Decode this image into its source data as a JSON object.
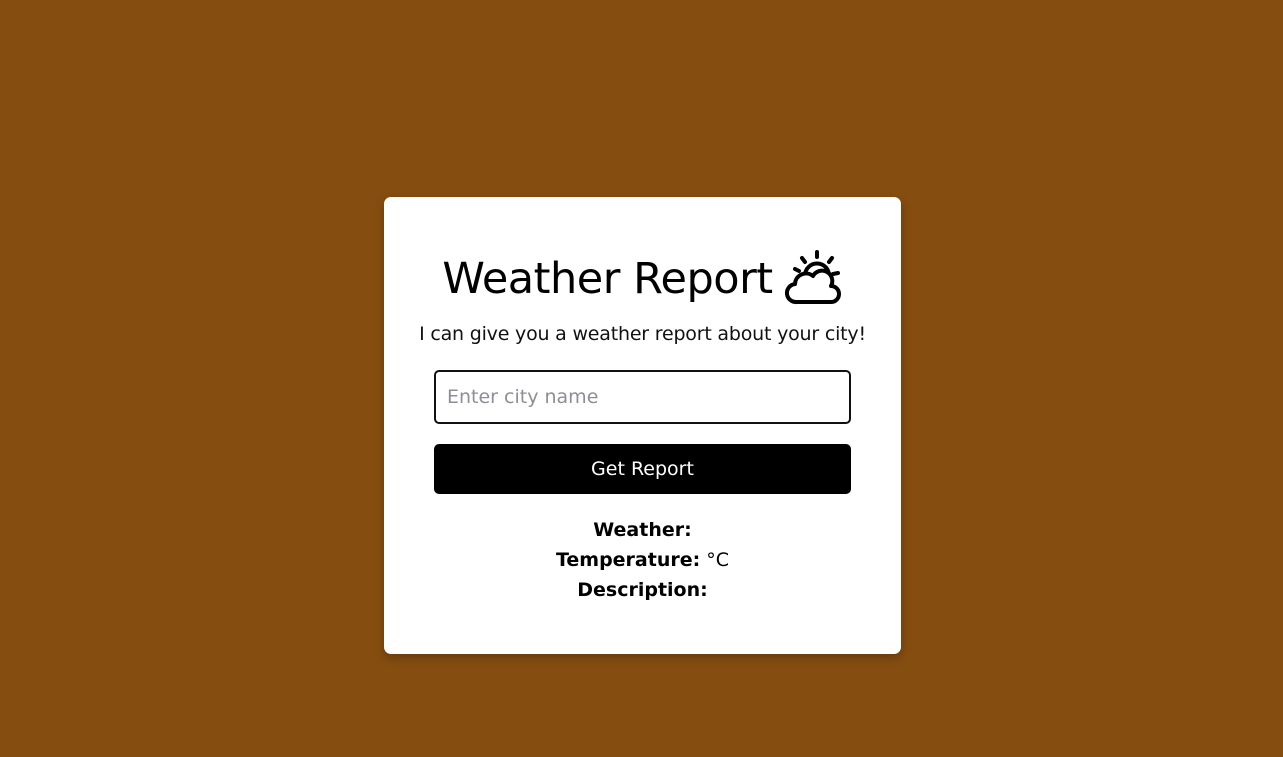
{
  "card": {
    "title": "Weather Report",
    "title_icon": "sun-behind-cloud-icon",
    "subtitle": "I can give you a weather report about your city!",
    "city_input": {
      "value": "",
      "placeholder": "Enter city name"
    },
    "button_label": "Get Report",
    "results": {
      "weather_label": "Weather:",
      "weather_value": "",
      "temperature_label": "Temperature:",
      "temperature_value": "",
      "temperature_unit": "°C",
      "description_label": "Description:",
      "description_value": ""
    }
  },
  "colors": {
    "background": "#864d10",
    "card": "#ffffff",
    "button": "#000000",
    "button_text": "#ffffff"
  }
}
